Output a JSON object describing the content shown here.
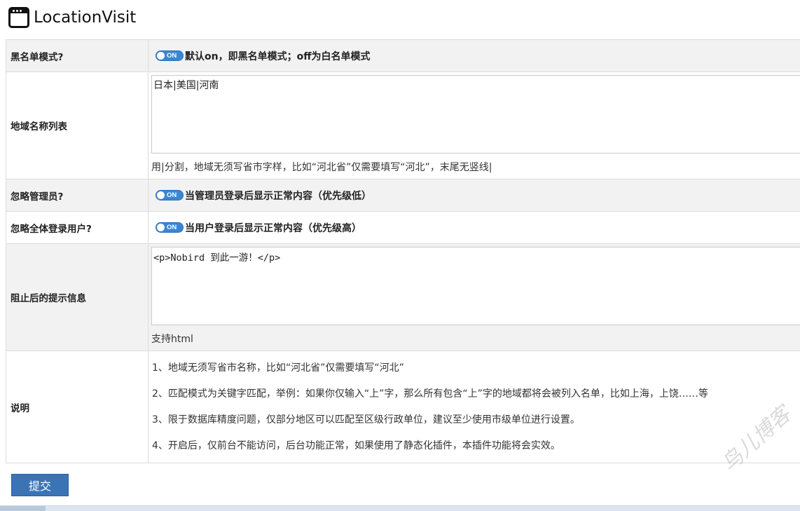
{
  "header": {
    "title": "LocationVisit",
    "icon": "browser-window-icon"
  },
  "rows": {
    "blacklist_mode": {
      "label": "黑名单模式?",
      "toggle_text": "ON",
      "description": "默认on，即黑名单模式；off为白名单模式"
    },
    "region_list": {
      "label": "地域名称列表",
      "value": "日本|美国|河南",
      "hint": "用|分割，地域无须写省市字样，比如“河北省”仅需要填写“河北”，末尾无竖线|"
    },
    "ignore_admin": {
      "label": "忽略管理员?",
      "toggle_text": "ON",
      "description": "当管理员登录后显示正常内容（优先级低）"
    },
    "ignore_logged_in": {
      "label": "忽略全体登录用户?",
      "toggle_text": "ON",
      "description": "当用户登录后显示正常内容（优先级高）"
    },
    "block_message": {
      "label": "阻止后的提示信息",
      "value": "<p>Nobird 到此一游！</p>",
      "hint": "支持html"
    },
    "notes": {
      "label": "说明",
      "items": [
        "1、地域无须写省市名称，比如“河北省”仅需要填写“河北”",
        "2、匹配模式为关键字匹配，举例：如果你仅输入“上”字，那么所有包含“上”字的地域都将会被列入名单，比如上海，上饶……等",
        "3、限于数据库精度问题，仅部分地区可以匹配至区级行政单位，建议至少使用市级单位进行设置。",
        "4、开启后，仅前台不能访问，后台功能正常，如果使用了静态化插件，本插件功能将会实效。"
      ]
    }
  },
  "submit": {
    "label": "提交"
  },
  "watermark": "鸟儿博客",
  "colors": {
    "toggle_on": "#3a86d4",
    "submit_button": "#3a74b5",
    "row_gray": "#f2f2f2"
  }
}
